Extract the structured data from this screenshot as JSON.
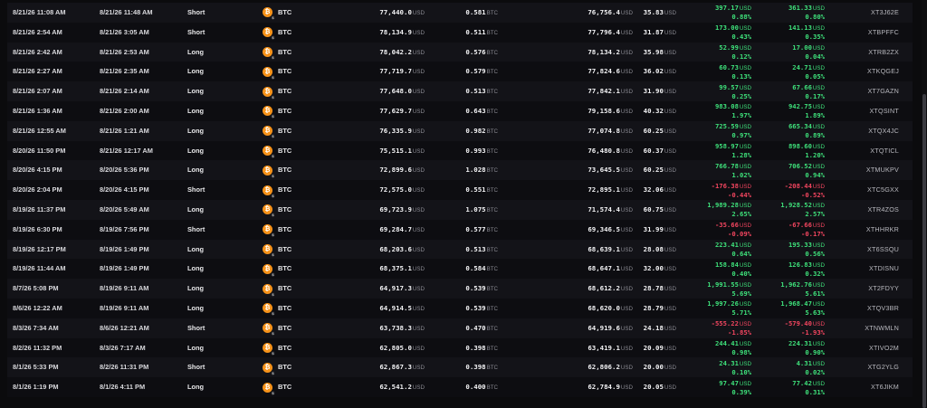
{
  "units": {
    "usd": "USD",
    "btc": "BTC"
  },
  "coin_icon": {
    "name": "bitcoin-icon",
    "symbol": "₿",
    "sub_symbol": "$",
    "color": "#f7931a"
  },
  "colors": {
    "positive": "#3ee07a",
    "negative": "#f2455f",
    "background": "#0b0b0d"
  },
  "trades": [
    {
      "open": "8/21/26 11:08 AM",
      "close": "8/21/26 11:48 AM",
      "side": "Short",
      "asset": "BTC",
      "entry": "77,440.0",
      "size": "0.581",
      "exit": "76,756.4",
      "fee": "35.83",
      "pnl": "397.17",
      "pnl_pct": "0.88%",
      "net": "361.33",
      "net_pct": "0.80%",
      "id": "XT3J62E",
      "sign": "pos"
    },
    {
      "open": "8/21/26 2:54 AM",
      "close": "8/21/26 3:05 AM",
      "side": "Short",
      "asset": "BTC",
      "entry": "78,134.9",
      "size": "0.511",
      "exit": "77,796.4",
      "fee": "31.87",
      "pnl": "173.00",
      "pnl_pct": "0.43%",
      "net": "141.13",
      "net_pct": "0.35%",
      "id": "XTBPFFC",
      "sign": "pos"
    },
    {
      "open": "8/21/26 2:42 AM",
      "close": "8/21/26 2:53 AM",
      "side": "Long",
      "asset": "BTC",
      "entry": "78,042.2",
      "size": "0.576",
      "exit": "78,134.2",
      "fee": "35.98",
      "pnl": "52.99",
      "pnl_pct": "0.12%",
      "net": "17.00",
      "net_pct": "0.04%",
      "id": "XTRB2ZX",
      "sign": "pos"
    },
    {
      "open": "8/21/26 2:27 AM",
      "close": "8/21/26 2:35 AM",
      "side": "Long",
      "asset": "BTC",
      "entry": "77,719.7",
      "size": "0.579",
      "exit": "77,824.6",
      "fee": "36.02",
      "pnl": "60.73",
      "pnl_pct": "0.13%",
      "net": "24.71",
      "net_pct": "0.05%",
      "id": "XTKQGEJ",
      "sign": "pos"
    },
    {
      "open": "8/21/26 2:07 AM",
      "close": "8/21/26 2:14 AM",
      "side": "Long",
      "asset": "BTC",
      "entry": "77,648.0",
      "size": "0.513",
      "exit": "77,842.1",
      "fee": "31.90",
      "pnl": "99.57",
      "pnl_pct": "0.25%",
      "net": "67.66",
      "net_pct": "0.17%",
      "id": "XT7GAZN",
      "sign": "pos"
    },
    {
      "open": "8/21/26 1:36 AM",
      "close": "8/21/26 2:00 AM",
      "side": "Long",
      "asset": "BTC",
      "entry": "77,629.7",
      "size": "0.643",
      "exit": "79,158.6",
      "fee": "40.32",
      "pnl": "983.08",
      "pnl_pct": "1.97%",
      "net": "942.75",
      "net_pct": "1.89%",
      "id": "XTQSINT",
      "sign": "pos"
    },
    {
      "open": "8/21/26 12:55 AM",
      "close": "8/21/26 1:21 AM",
      "side": "Long",
      "asset": "BTC",
      "entry": "76,335.9",
      "size": "0.982",
      "exit": "77,074.8",
      "fee": "60.25",
      "pnl": "725.59",
      "pnl_pct": "0.97%",
      "net": "665.34",
      "net_pct": "0.89%",
      "id": "XTQX4JC",
      "sign": "pos"
    },
    {
      "open": "8/20/26 11:50 PM",
      "close": "8/21/26 12:17 AM",
      "side": "Long",
      "asset": "BTC",
      "entry": "75,515.1",
      "size": "0.993",
      "exit": "76,480.8",
      "fee": "60.37",
      "pnl": "958.97",
      "pnl_pct": "1.28%",
      "net": "898.60",
      "net_pct": "1.20%",
      "id": "XTQTICL",
      "sign": "pos"
    },
    {
      "open": "8/20/26 4:15 PM",
      "close": "8/20/26 5:36 PM",
      "side": "Long",
      "asset": "BTC",
      "entry": "72,899.6",
      "size": "1.028",
      "exit": "73,645.5",
      "fee": "60.25",
      "pnl": "766.78",
      "pnl_pct": "1.02%",
      "net": "706.52",
      "net_pct": "0.94%",
      "id": "XTMUKPV",
      "sign": "pos"
    },
    {
      "open": "8/20/26 2:04 PM",
      "close": "8/20/26 4:15 PM",
      "side": "Short",
      "asset": "BTC",
      "entry": "72,575.0",
      "size": "0.551",
      "exit": "72,895.1",
      "fee": "32.06",
      "pnl": "-176.38",
      "pnl_pct": "-0.44%",
      "net": "-208.44",
      "net_pct": "-0.52%",
      "id": "XTC5GXX",
      "sign": "neg"
    },
    {
      "open": "8/19/26 11:37 PM",
      "close": "8/20/26 5:49 AM",
      "side": "Long",
      "asset": "BTC",
      "entry": "69,723.9",
      "size": "1.075",
      "exit": "71,574.4",
      "fee": "60.75",
      "pnl": "1,989.28",
      "pnl_pct": "2.65%",
      "net": "1,928.52",
      "net_pct": "2.57%",
      "id": "XTR4ZOS",
      "sign": "pos"
    },
    {
      "open": "8/19/26 6:30 PM",
      "close": "8/19/26 7:56 PM",
      "side": "Short",
      "asset": "BTC",
      "entry": "69,284.7",
      "size": "0.577",
      "exit": "69,346.5",
      "fee": "31.99",
      "pnl": "-35.66",
      "pnl_pct": "-0.09%",
      "net": "-67.66",
      "net_pct": "-0.17%",
      "id": "XTHHRKR",
      "sign": "neg"
    },
    {
      "open": "8/19/26 12:17 PM",
      "close": "8/19/26 1:49 PM",
      "side": "Long",
      "asset": "BTC",
      "entry": "68,203.6",
      "size": "0.513",
      "exit": "68,639.1",
      "fee": "28.08",
      "pnl": "223.41",
      "pnl_pct": "0.64%",
      "net": "195.33",
      "net_pct": "0.56%",
      "id": "XT6SSQU",
      "sign": "pos"
    },
    {
      "open": "8/19/26 11:44 AM",
      "close": "8/19/26 1:49 PM",
      "side": "Long",
      "asset": "BTC",
      "entry": "68,375.1",
      "size": "0.584",
      "exit": "68,647.1",
      "fee": "32.00",
      "pnl": "158.84",
      "pnl_pct": "0.40%",
      "net": "126.83",
      "net_pct": "0.32%",
      "id": "XTDISNU",
      "sign": "pos"
    },
    {
      "open": "8/7/26 5:08 PM",
      "close": "8/19/26 9:11 AM",
      "side": "Long",
      "asset": "BTC",
      "entry": "64,917.3",
      "size": "0.539",
      "exit": "68,612.2",
      "fee": "28.78",
      "pnl": "1,991.55",
      "pnl_pct": "5.69%",
      "net": "1,962.76",
      "net_pct": "5.61%",
      "id": "XT2FDYY",
      "sign": "pos"
    },
    {
      "open": "8/6/26 12:22 AM",
      "close": "8/19/26 9:11 AM",
      "side": "Long",
      "asset": "BTC",
      "entry": "64,914.5",
      "size": "0.539",
      "exit": "68,620.0",
      "fee": "28.79",
      "pnl": "1,997.26",
      "pnl_pct": "5.71%",
      "net": "1,968.47",
      "net_pct": "5.63%",
      "id": "XTQV3BR",
      "sign": "pos"
    },
    {
      "open": "8/3/26 7:34 AM",
      "close": "8/6/26 12:21 AM",
      "side": "Short",
      "asset": "BTC",
      "entry": "63,738.3",
      "size": "0.470",
      "exit": "64,919.6",
      "fee": "24.18",
      "pnl": "-555.22",
      "pnl_pct": "-1.85%",
      "net": "-579.40",
      "net_pct": "-1.93%",
      "id": "XTNWMLN",
      "sign": "neg"
    },
    {
      "open": "8/2/26 11:32 PM",
      "close": "8/3/26 7:17 AM",
      "side": "Long",
      "asset": "BTC",
      "entry": "62,805.0",
      "size": "0.398",
      "exit": "63,419.1",
      "fee": "20.09",
      "pnl": "244.41",
      "pnl_pct": "0.98%",
      "net": "224.31",
      "net_pct": "0.90%",
      "id": "XTIVO2M",
      "sign": "pos"
    },
    {
      "open": "8/1/26 5:33 PM",
      "close": "8/2/26 11:31 PM",
      "side": "Short",
      "asset": "BTC",
      "entry": "62,867.3",
      "size": "0.398",
      "exit": "62,806.2",
      "fee": "20.00",
      "pnl": "24.31",
      "pnl_pct": "0.10%",
      "net": "4.31",
      "net_pct": "0.02%",
      "id": "XTG2YLG",
      "sign": "pos"
    },
    {
      "open": "8/1/26 1:19 PM",
      "close": "8/1/26 4:11 PM",
      "side": "Long",
      "asset": "BTC",
      "entry": "62,541.2",
      "size": "0.400",
      "exit": "62,784.9",
      "fee": "20.05",
      "pnl": "97.47",
      "pnl_pct": "0.39%",
      "net": "77.42",
      "net_pct": "0.31%",
      "id": "XT6JIKM",
      "sign": "pos"
    }
  ]
}
